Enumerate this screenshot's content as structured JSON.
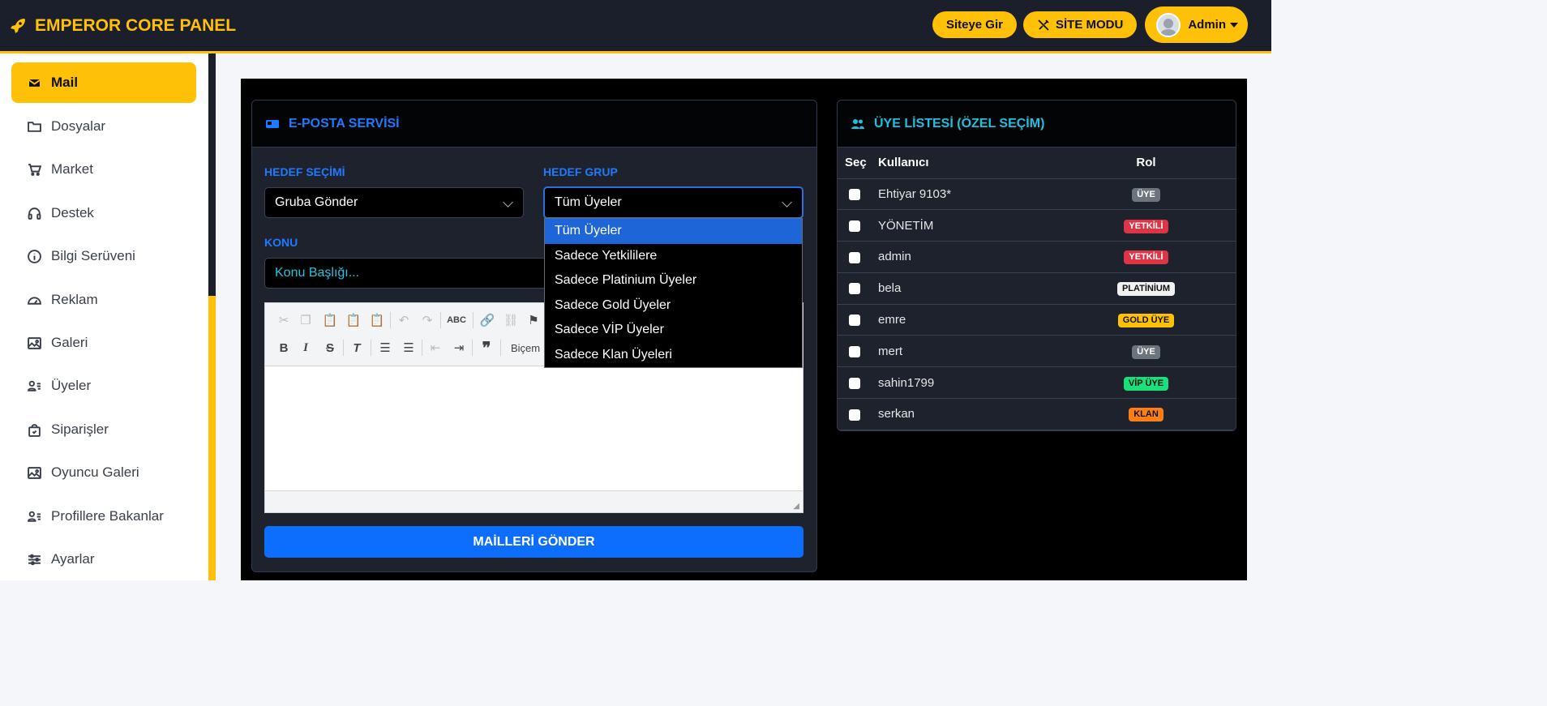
{
  "header": {
    "brand": "EMPEROR CORE PANEL",
    "site_button": "Siteye Gir",
    "mode_button": "SİTE MODU",
    "user_button": "Admin"
  },
  "sidebar": {
    "items": [
      {
        "label": "Mail",
        "icon": "envelope-icon",
        "active": true
      },
      {
        "label": "Dosyalar",
        "icon": "folder-icon"
      },
      {
        "label": "Market",
        "icon": "cart-icon"
      },
      {
        "label": "Destek",
        "icon": "headset-icon"
      },
      {
        "label": "Bilgi Serüveni",
        "icon": "info-icon"
      },
      {
        "label": "Reklam",
        "icon": "speedometer-icon"
      },
      {
        "label": "Galeri",
        "icon": "image-icon"
      },
      {
        "label": "Üyeler",
        "icon": "person-lines-icon"
      },
      {
        "label": "Siparişler",
        "icon": "bag-check-icon"
      },
      {
        "label": "Oyuncu Galeri",
        "icon": "image-icon"
      },
      {
        "label": "Profillere Bakanlar",
        "icon": "person-lines-icon"
      },
      {
        "label": "Ayarlar",
        "icon": "sliders-icon"
      }
    ]
  },
  "mail_card": {
    "title": "E-POSTA SERVİSİ",
    "target_label": "HEDEF SEÇİMİ",
    "target_value": "Gruba Gönder",
    "group_label": "HEDEF GRUP",
    "group_value": "Tüm Üyeler",
    "subject_label": "KONU",
    "subject_placeholder": "Konu Başlığı...",
    "format_label": "Biçem",
    "send_button": "MAİLLERİ GÖNDER",
    "group_options": [
      "Tüm Üyeler",
      "Sadece Yetkililere",
      "Sadece Platinium Üyeler",
      "Sadece Gold Üyeler",
      "Sadece VİP Üyeler",
      "Sadece Klan Üyeleri"
    ]
  },
  "members_card": {
    "title": "ÜYE LİSTESİ (ÖZEL SEÇİM)",
    "columns": [
      "Seç",
      "Kullanıcı",
      "Rol"
    ],
    "rows": [
      {
        "user": "Ehtiyar 9103*",
        "role": "ÜYE",
        "bg": "#6c757d",
        "fg": "#ffffff"
      },
      {
        "user": "YÖNETİM",
        "role": "YETKİLİ",
        "bg": "#dc3545",
        "fg": "#ffffff"
      },
      {
        "user": "admin",
        "role": "YETKİLİ",
        "bg": "#dc3545",
        "fg": "#ffffff"
      },
      {
        "user": "bela",
        "role": "PLATİNİUM",
        "bg": "#f1f1f1",
        "fg": "#111111"
      },
      {
        "user": "emre",
        "role": "GOLD ÜYE",
        "bg": "#ffc107",
        "fg": "#111111"
      },
      {
        "user": "mert",
        "role": "ÜYE",
        "bg": "#6c757d",
        "fg": "#ffffff"
      },
      {
        "user": "sahin1799",
        "role": "VİP ÜYE",
        "bg": "#19e07a",
        "fg": "#111111"
      },
      {
        "user": "serkan",
        "role": "KLAN",
        "bg": "#fd7e14",
        "fg": "#111111"
      }
    ]
  },
  "colors": {
    "accent": "#ffc107",
    "primary": "#0d6efd",
    "topbar": "#1b1e2b"
  }
}
